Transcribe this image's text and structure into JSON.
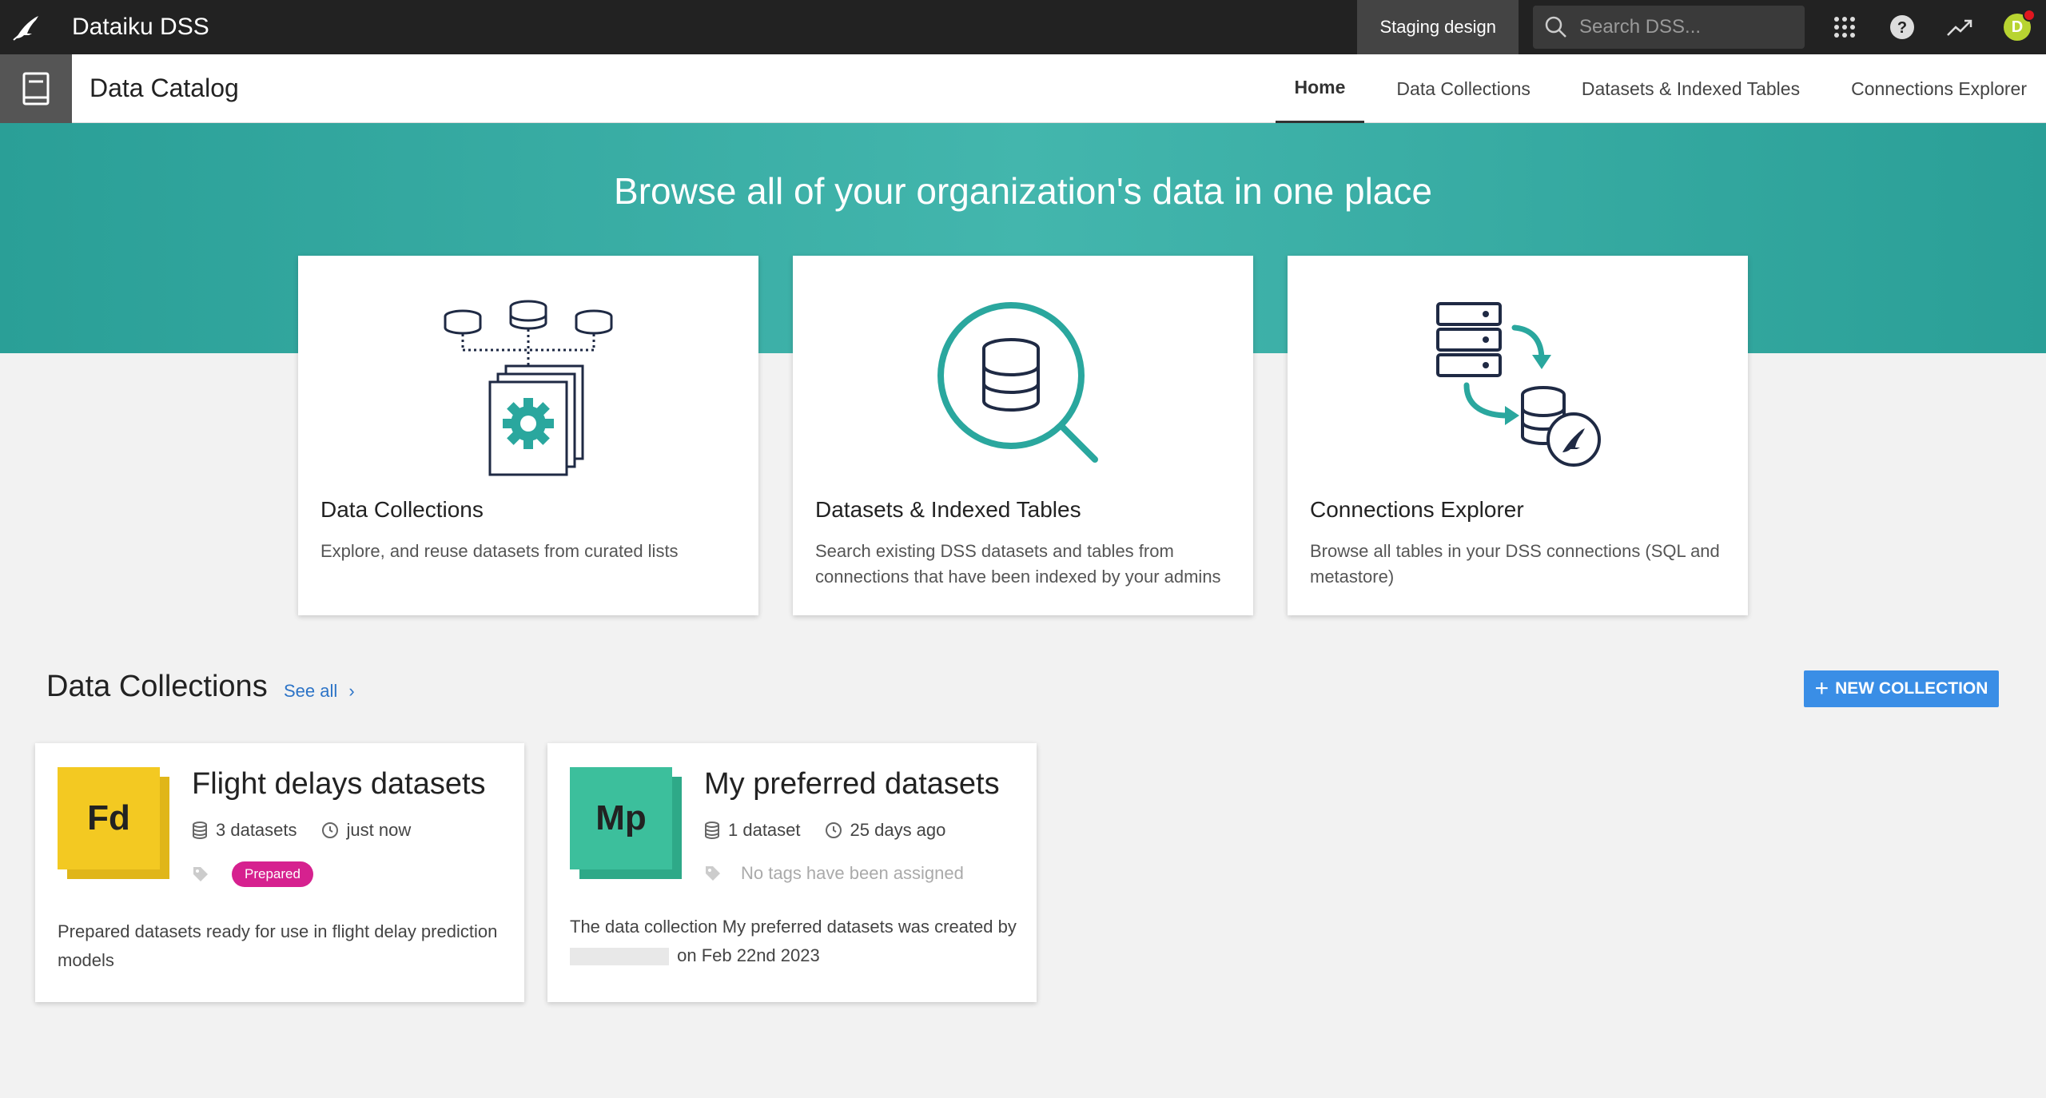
{
  "topbar": {
    "app_title": "Dataiku DSS",
    "staging_label": "Staging design",
    "search_placeholder": "Search DSS...",
    "avatar_letter": "D"
  },
  "subheader": {
    "title": "Data Catalog",
    "tabs": [
      {
        "label": "Home"
      },
      {
        "label": "Data Collections"
      },
      {
        "label": "Datasets & Indexed Tables"
      },
      {
        "label": "Connections Explorer"
      }
    ]
  },
  "hero": {
    "title": "Browse all of your organization's data in one place"
  },
  "feature_cards": [
    {
      "title": "Data Collections",
      "description": "Explore, and reuse datasets from curated lists"
    },
    {
      "title": "Datasets & Indexed Tables",
      "description": "Search existing DSS datasets and tables from connections that have been indexed by your admins"
    },
    {
      "title": "Connections Explorer",
      "description": "Browse all tables in your DSS connections (SQL and metastore)"
    }
  ],
  "collections_section": {
    "title": "Data Collections",
    "see_all": "See all",
    "new_collection": "NEW COLLECTION"
  },
  "collections": [
    {
      "initials": "Fd",
      "title": "Flight delays datasets",
      "datasets": "3 datasets",
      "time": "just now",
      "tag": "Prepared",
      "description": "Prepared datasets ready for use in flight delay prediction models"
    },
    {
      "initials": "Mp",
      "title": "My preferred datasets",
      "datasets": "1 dataset",
      "time": "25 days ago",
      "no_tags": "No tags have been assigned",
      "description_line1": "The data collection My preferred datasets was created by",
      "description_line2": "on Feb 22nd 2023"
    }
  ],
  "colors": {
    "teal": "#2aa79e",
    "accent_blue": "#3a8ee6",
    "tag_pink": "#d6218f",
    "fd_yellow": "#f3c922",
    "mp_green": "#3cbf9c"
  }
}
